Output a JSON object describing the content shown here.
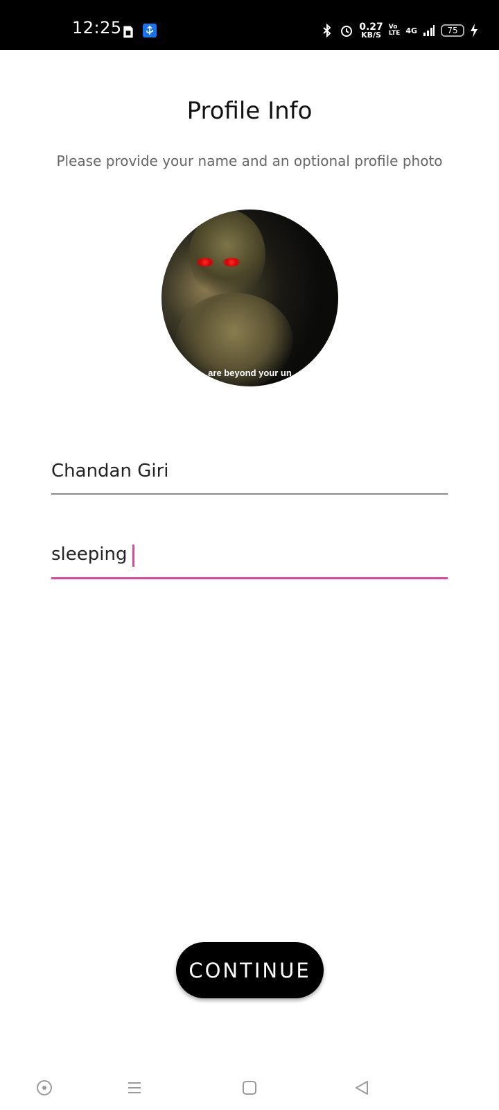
{
  "status_bar": {
    "time": "12:25",
    "speed_value": "0.27",
    "speed_unit": "KB/S",
    "volte_top": "Vo",
    "volte_bottom": "LTE",
    "network": "4G",
    "battery": "75"
  },
  "header": {
    "title": "Profile Info",
    "subtitle": "Please provide your name and an optional profile photo"
  },
  "avatar": {
    "caption": "are beyond your un"
  },
  "form": {
    "name_value": "Chandan Giri",
    "about_value": "sleeping"
  },
  "actions": {
    "continue_label": "CONTINUE"
  },
  "colors": {
    "accent": "#e1449b",
    "button": "#000000"
  }
}
